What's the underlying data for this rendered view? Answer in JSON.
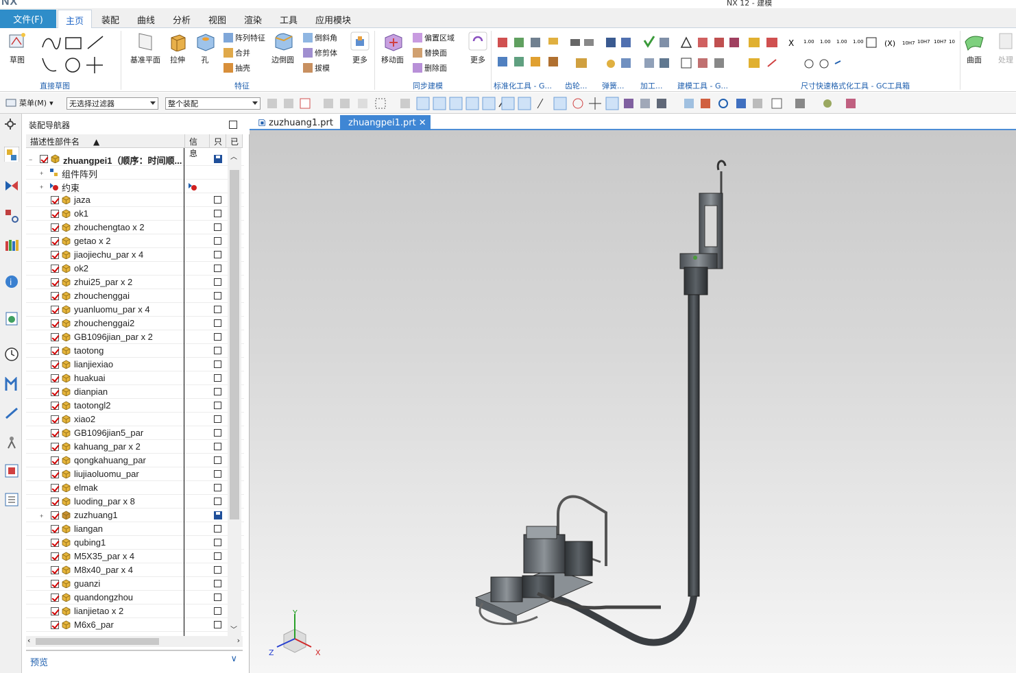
{
  "window": {
    "logo": "NX",
    "title": "NX 12 - 建模"
  },
  "menu": {
    "file": "文件(F)",
    "tabs": [
      "主页",
      "装配",
      "曲线",
      "分析",
      "视图",
      "渲染",
      "工具",
      "应用模块"
    ],
    "active_tab": "主页"
  },
  "ribbon": {
    "groups": {
      "direct_sketch": "直接草图",
      "feature": "特征",
      "sync": "同步建模",
      "std": "标准化工具 - G...",
      "gear": "齿轮...",
      "spring": "弹簧...",
      "machining": "加工...",
      "modeling_tools": "建模工具 - G...",
      "dim": "尺寸快速格式化工具 - GC工具箱"
    },
    "buttons": {
      "sketch": "草图",
      "datum_plane": "基准平面",
      "extrude": "拉伸",
      "hole": "孔",
      "pattern": "阵列特征",
      "unite": "合并",
      "shell": "抽壳",
      "edge_blend": "边倒圆",
      "chamfer": "倒斜角",
      "trim_body": "修剪体",
      "draft": "拔模",
      "more1": "更多",
      "move_face": "移动面",
      "offset_region": "偏置区域",
      "replace_face": "替换面",
      "delete_face": "删除面",
      "more2": "更多",
      "surface": "曲面",
      "process": "处理"
    }
  },
  "toolbar2": {
    "menu": "菜单(M)",
    "filter": "无选择过滤器",
    "scope": "整个装配"
  },
  "navigator": {
    "title": "装配导航器",
    "columns": [
      "描述性部件名",
      "信息",
      "只",
      "已"
    ],
    "root": "zhuangpei1（顺序：时间顺...",
    "items": [
      {
        "name": "组件阵列",
        "kind": "array"
      },
      {
        "name": "约束",
        "kind": "constraint"
      },
      {
        "name": "jaza"
      },
      {
        "name": "ok1"
      },
      {
        "name": "zhouchengtao x 2"
      },
      {
        "name": "getao x 2"
      },
      {
        "name": "jiaojiechu_par x 4"
      },
      {
        "name": "ok2"
      },
      {
        "name": "zhui25_par x 2"
      },
      {
        "name": "zhouchenggai"
      },
      {
        "name": "yuanluomu_par x 4"
      },
      {
        "name": "zhouchenggai2"
      },
      {
        "name": "GB1096jian_par x 2"
      },
      {
        "name": "taotong"
      },
      {
        "name": "lianjiexiao"
      },
      {
        "name": "huakuai"
      },
      {
        "name": "dianpian"
      },
      {
        "name": "taotongl2"
      },
      {
        "name": "xiao2"
      },
      {
        "name": "GB1096jian5_par"
      },
      {
        "name": "kahuang_par x 2"
      },
      {
        "name": "qongkahuang_par"
      },
      {
        "name": "liujiaoluomu_par"
      },
      {
        "name": "elmak"
      },
      {
        "name": "luoding_par x 8"
      },
      {
        "name": "zuzhuang1",
        "kind": "sub"
      },
      {
        "name": "liangan"
      },
      {
        "name": "qubing1"
      },
      {
        "name": "M5X35_par x 4"
      },
      {
        "name": "M8x40_par x 4"
      },
      {
        "name": "guanzi"
      },
      {
        "name": "quandongzhou"
      },
      {
        "name": "lianjietao x 2"
      },
      {
        "name": "M6x6_par"
      }
    ],
    "preview": "预览"
  },
  "view_tabs": [
    {
      "label": "zuzhuang1.prt",
      "active": false
    },
    {
      "label": "zhuangpei1.prt",
      "active": true
    }
  ],
  "triad": {
    "x": "X",
    "y": "Y",
    "z": "Z"
  }
}
